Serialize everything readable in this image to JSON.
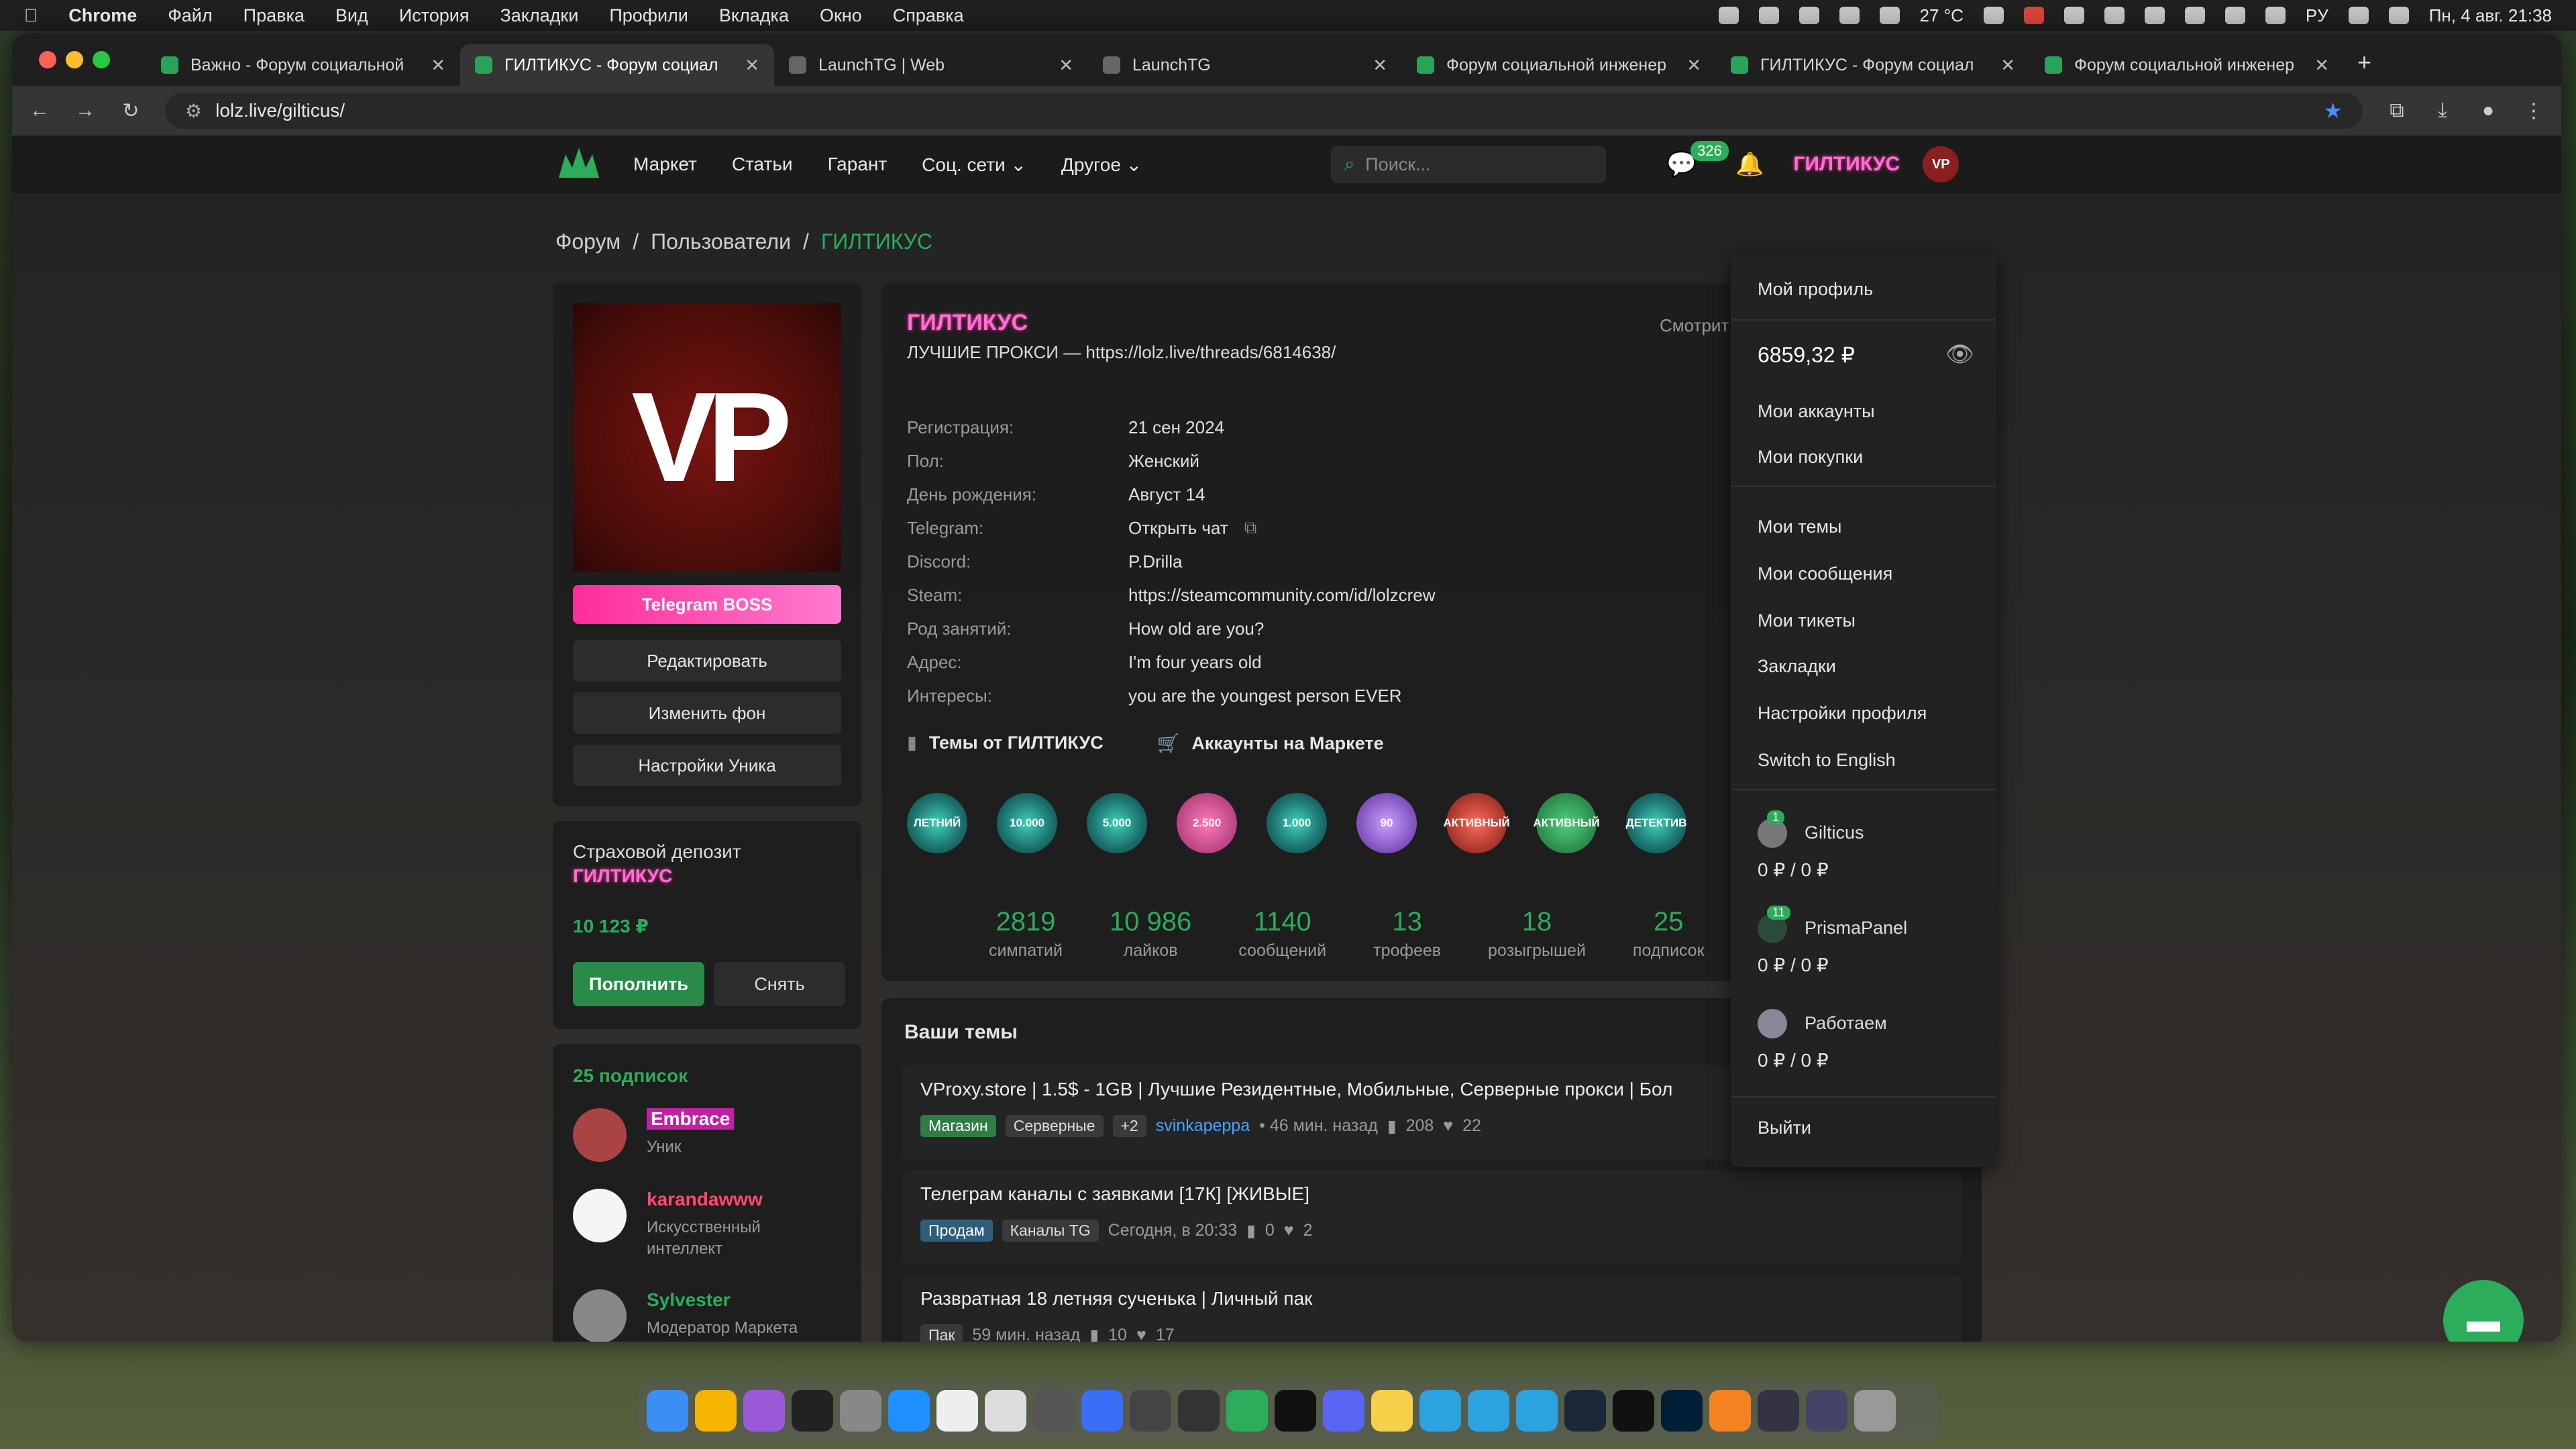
{
  "menubar": {
    "app": "Chrome",
    "items": [
      "Файл",
      "Правка",
      "Вид",
      "История",
      "Закладки",
      "Профили",
      "Вкладка",
      "Окно",
      "Справка"
    ],
    "weather": "27 °C",
    "input": "PУ",
    "datetime": "Пн, 4 авг. 21:38"
  },
  "tabs": [
    {
      "title": "Важно - Форум социальной"
    },
    {
      "title": "ГИЛТИКУС - Форум социал"
    },
    {
      "title": "LaunchTG | Web"
    },
    {
      "title": "LaunchTG"
    },
    {
      "title": "Форум социальной инженер"
    },
    {
      "title": "ГИЛТИКУС - Форум социал"
    },
    {
      "title": "Форум социальной инженер"
    }
  ],
  "url": "lolz.live/gilticus/",
  "sitenav": {
    "items": [
      "Маркет",
      "Статьи",
      "Гарант",
      "Соц. сети",
      "Другое"
    ],
    "search_placeholder": "Поиск...",
    "msg_count": "326",
    "username": "ГИЛТИКУС",
    "avatar_text": "VP"
  },
  "breadcrumb": [
    "Форум",
    "Пользователи",
    "ГИЛТИКУС"
  ],
  "left": {
    "avatar_text": "VP",
    "banner": "Telegram BOSS",
    "buttons": [
      "Редактировать",
      "Изменить фон",
      "Настройки Уника"
    ]
  },
  "deposit": {
    "title": "Страховой депозит",
    "name": "ГИЛТИКУС",
    "amount": "10 123 ₽",
    "topup": "Пополнить",
    "withdraw": "Снять"
  },
  "follows": {
    "header": "25 подписок",
    "items": [
      {
        "name": "Embrace",
        "role": "Уник"
      },
      {
        "name": "karandawww",
        "role": "Искусственный интеллект"
      },
      {
        "name": "Sylvester",
        "role": "Модератор Маркета"
      }
    ]
  },
  "profile": {
    "name": "ГИЛТИКУС",
    "status": "ЛУЧШИЕ ПРОКСИ — https://lolz.live/threads/6814638/",
    "watching": "Смотрит",
    "info": [
      {
        "k": "Регистрация:",
        "v": "21 сен 2024"
      },
      {
        "k": "Пол:",
        "v": "Женский"
      },
      {
        "k": "День рождения:",
        "v": "Август 14"
      },
      {
        "k": "Telegram:",
        "v": "Открыть чат"
      },
      {
        "k": "Discord:",
        "v": "P.Drilla"
      },
      {
        "k": "Steam:",
        "v": "https://steamcommunity.com/id/lolzcrew"
      },
      {
        "k": "Род занятий:",
        "v": "How old are you?"
      },
      {
        "k": "Адрес:",
        "v": "I'm four years old"
      },
      {
        "k": "Интересы:",
        "v": "you are the youngest person EVER"
      }
    ],
    "links": [
      "Темы от ГИЛТИКУС",
      "Аккаунты на Маркете"
    ],
    "trophies": [
      "ЛЕТНИЙ",
      "10.000",
      "5.000",
      "2.500",
      "1.000",
      "90",
      "АКТИВНЫЙ",
      "АКТИВНЫЙ",
      "ДЕТЕКТИВ"
    ],
    "stats": [
      {
        "v": "2819",
        "l": "симпатий"
      },
      {
        "v": "10 986",
        "l": "лайков"
      },
      {
        "v": "1140",
        "l": "сообщений"
      },
      {
        "v": "13",
        "l": "трофеев"
      },
      {
        "v": "18",
        "l": "розыгрышей"
      },
      {
        "v": "25",
        "l": "подписок"
      }
    ]
  },
  "threads": {
    "header": "Ваши темы",
    "items": [
      {
        "title": "VProxy.store | 1.5$ - 1GB | Лучшие Резидентные, Мобильные, Серверные прокси | Бол",
        "tag1": "Магазин",
        "tag2": "Серверные",
        "tag3": "+2",
        "author": "svinkapeppa",
        "time": "• 46 мин. назад",
        "replies": "208",
        "likes": "22"
      },
      {
        "title": "Телеграм каналы с заявками [17К] [ЖИВЫЕ]",
        "tag1": "Продам",
        "tag2": "Каналы TG",
        "time": "Сегодня, в 20:33",
        "replies": "0",
        "likes": "2"
      },
      {
        "title": "Развратная 18 летняя сученька | Личный пак",
        "tag1": "Пак",
        "time": "59 мин. назад",
        "replies": "10",
        "likes": "17"
      }
    ]
  },
  "dropdown": {
    "profile": "Мой профиль",
    "balance": "6859,32 ₽",
    "items1": [
      "Мои аккаунты",
      "Мои покупки"
    ],
    "items2": [
      "Мои темы",
      "Мои сообщения",
      "Мои тикеты",
      "Закладки",
      "Настройки профиля",
      "Switch to English"
    ],
    "accounts": [
      {
        "name": "Gilticus",
        "badge": "1",
        "bal": "0 ₽  /  0 ₽"
      },
      {
        "name": "PrismaPanel",
        "badge": "11",
        "bal": "0 ₽  /  0 ₽"
      },
      {
        "name": "Работаем",
        "badge": "",
        "bal": "0 ₽  /  0 ₽"
      }
    ],
    "logout": "Выйти"
  }
}
